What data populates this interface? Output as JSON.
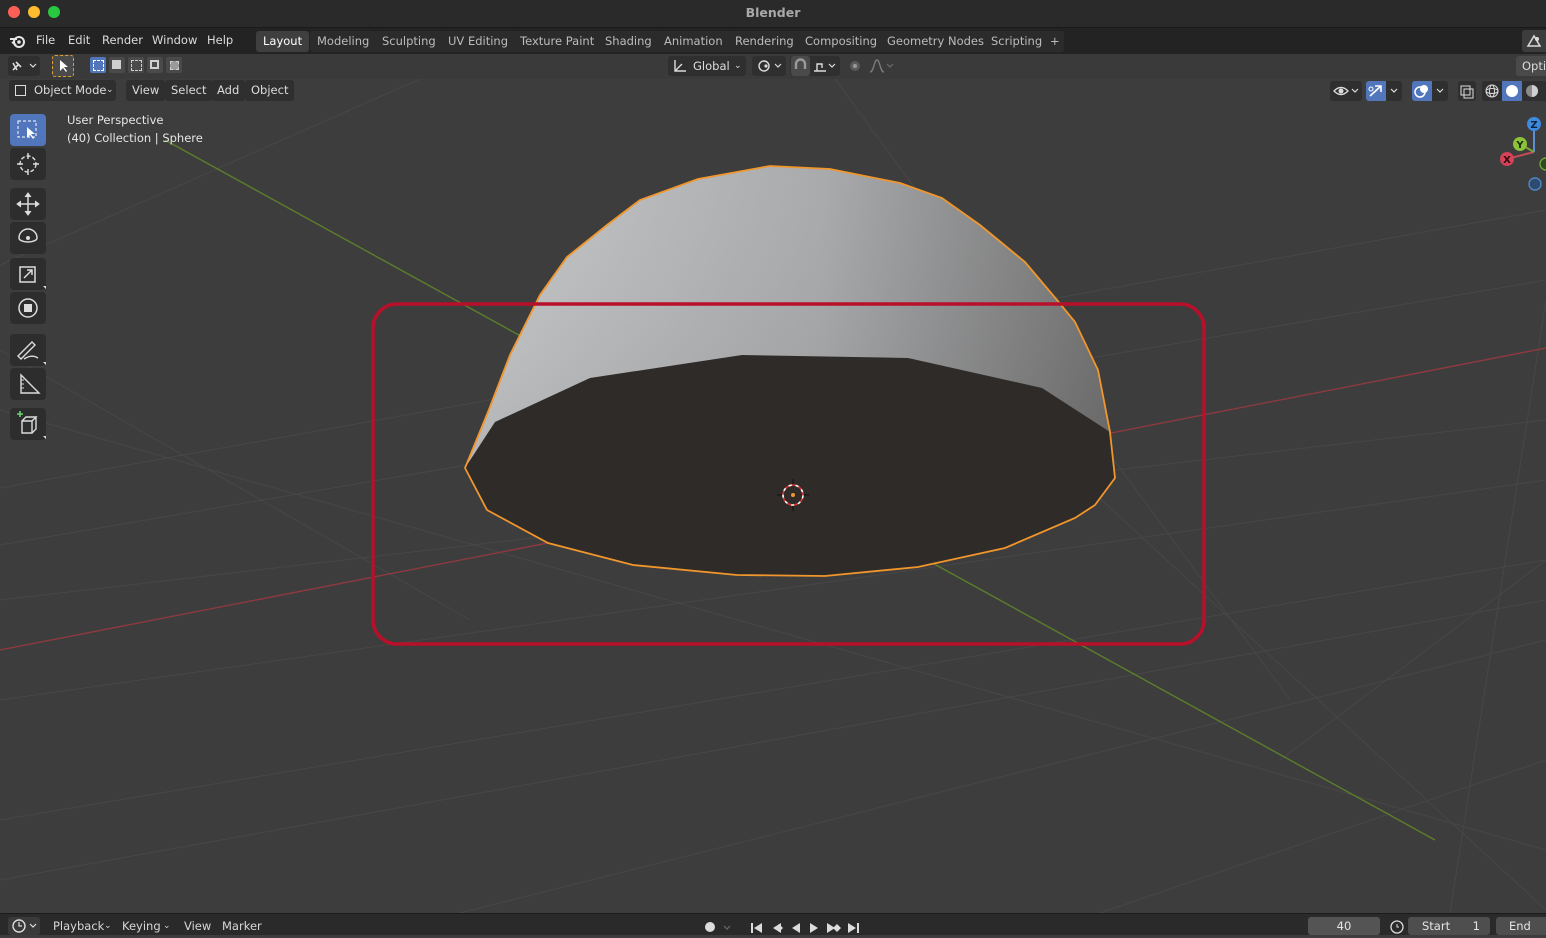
{
  "window": {
    "title": "Blender"
  },
  "menu": {
    "file": "File",
    "edit": "Edit",
    "render": "Render",
    "window": "Window",
    "help": "Help"
  },
  "workspaces": [
    "Layout",
    "Modeling",
    "Sculpting",
    "UV Editing",
    "Texture Paint",
    "Shading",
    "Animation",
    "Rendering",
    "Compositing",
    "Geometry Nodes",
    "Scripting"
  ],
  "active_workspace": "Layout",
  "header": {
    "transform_orientation": "Global",
    "options_label": "Opti"
  },
  "viewport_header": {
    "mode": "Object Mode",
    "view": "View",
    "select": "Select",
    "add": "Add",
    "object": "Object"
  },
  "viewport_info": {
    "perspective": "User Perspective",
    "collection": "(40) Collection | Sphere"
  },
  "gizmo": {
    "x": "X",
    "y": "Y",
    "z": "Z"
  },
  "timeline": {
    "playback": "Playback",
    "keying": "Keying",
    "view": "View",
    "marker": "Marker",
    "current_frame": "40",
    "start_label": "Start",
    "start_value": "1",
    "end_label": "End"
  },
  "colors": {
    "selection_outline": "#f0962c",
    "highlight_box": "#b8102a",
    "x_axis": "#a83c44",
    "y_axis": "#6a8c2a",
    "active_tool": "#5276bb"
  }
}
